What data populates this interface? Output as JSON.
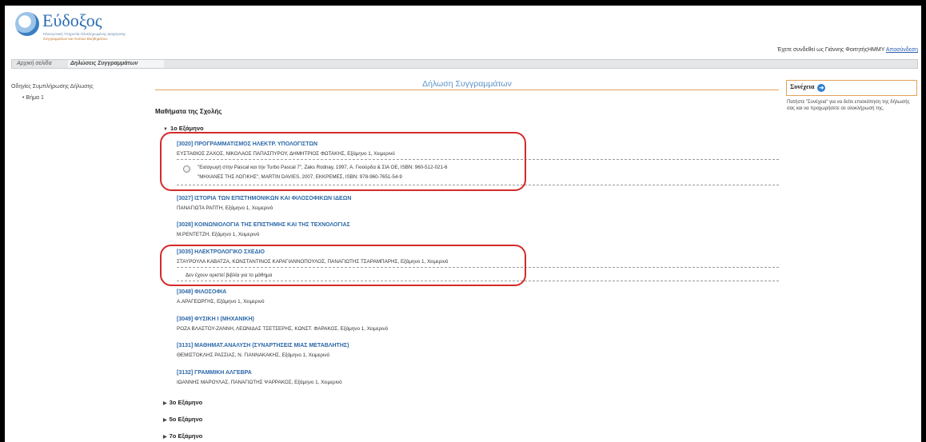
{
  "header": {
    "logo_name": "Εύδοξος",
    "logo_sub1": "Ηλεκτρονική Υπηρεσία Ολοκληρωμένης Διαχείρισης",
    "logo_sub2": "Συγγραμμάτων και Λοιπών Βοηθημάτων",
    "user_text": "Έχετε συνδεθεί ως Γιάννης ΦοιτητήςΗΜΜΥ",
    "logout_label": "Αποσύνδεση"
  },
  "tabs": {
    "home": "Αρχική σελίδα",
    "declarations": "Δηλώσεις Συγγραμμάτων"
  },
  "sidebar": {
    "title": "Οδηγίες Συμπλήρωσης Δήλωσης",
    "step": "• Βήμα 1"
  },
  "main": {
    "title": "Δήλωση Συγγραμμάτων",
    "school_title": "Μαθήματα της Σχολής",
    "semester_open": "1ο Εξάμηνο",
    "courses": [
      {
        "title": "[3020] ΠΡΟΓΡΑΜΜΑΤΙΣΜΟΣ ΗΛΕΚΤΡ. ΥΠΟΛΟΓΙΣΤΩΝ",
        "sub": "ΕΥΣΤΑΘΙΟΣ ΖΑΧΟΣ, ΝΙΚΟΛΑΟΣ ΠΑΠΑΣΠΥΡΟΥ, ΔΗΜΗΤΡΙΟΣ ΦΩΤΑΚΗΣ, Εξάμηνο 1, Χειμερινό",
        "book_line1": "\"Εισαγωγή στην Pascal και την Turbo Pascal 7\", Zaks Rodnay, 1997, Α. Γκιούρδα & ΣΙΑ ΟΕ, ISBN: 960-512-021-6",
        "book_line2": "\"ΜΗΧΑΝΕΣ ΤΗΣ ΛΟΓΙΚΗΣ\", MARTIN DAVIES, 2007, ΕΚΚΡΕΜΕΣ, ISBN: 978-960-7651-54-9"
      },
      {
        "title": "[3027] ΙΣΤΟΡΙΑ ΤΩΝ ΕΠΙΣΤΗΜΟΝΙΚΩΝ ΚΑΙ ΦΙΛΟΣΟΦΙΚΩΝ ΙΔΕΩΝ",
        "sub": "ΠΑΝΑΓΙΩΤΑ ΡΑΠΤΗ, Εξάμηνο 1, Χειμερινό"
      },
      {
        "title": "[3028] ΚΟΙΝΩΝΙΟΛΟΓΙΑ ΤΗΣ ΕΠΙΣΤΗΜΗΣ ΚΑΙ ΤΗΣ ΤΕΧΝΟΛΟΓΙΑΣ",
        "sub": "Μ.ΡΕΝΤΕΤΖΗ, Εξάμηνο 1, Χειμερινό"
      },
      {
        "title": "[3035] ΗΛΕΚΤΡΟΛΟΓΙΚΟ ΣΧΕΔΙΟ",
        "sub": "ΣΤΑΥΡΟΥΛΑ ΚΑΒΑΤΖΑ, ΚΩΝΣΤΑΝΤΙΝΟΣ ΚΑΡΑΓΙΑΝΝΟΠΟΥΛΟΣ, ΠΑΝΑΓΙΩΤΗΣ ΤΣΑΡΑΜΠΑΡΗΣ, Εξάμηνο 1, Χειμερινό",
        "no_books": "Δεν έχουν οριστεί βιβλία για το μάθημα"
      },
      {
        "title": "[3048] ΦΙΛΟΣΟΦΙΑ",
        "sub": "Α.ΑΡΑΓΕΩΡΓΗΣ, Εξάμηνο 1, Χειμερινό"
      },
      {
        "title": "[3049] ΦΥΣΙΚΗ Ι (ΜΗΧΑΝΙΚΗ)",
        "sub": "ΡΟΖΑ ΒΛΑΣΤΟΥ-ΖΑΝΝΗ, ΛΕΩΝΙΔΑΣ ΤΣΕΤΣΕΡΗΣ, ΚΩΝΣΤ. ΦΑΡΑΚΟΣ, Εξάμηνο 1, Χειμερινό"
      },
      {
        "title": "[3131] ΜΑΘΗΜΑΤ.ΑΝΑΛΥΣΗ (ΣΥΝΑΡΤΗΣΕΙΣ ΜΙΑΣ ΜΕΤΑΒΛΗΤΗΣ)",
        "sub": "ΘΕΜΙΣΤΟΚΛΗΣ ΡΑΣΣΙΑΣ, Ν. ΓΙΑΝΝΑΚΑΚΗΣ, Εξάμηνο 1, Χειμερινό"
      },
      {
        "title": "[3132] ΓΡΑΜΜΙΚΗ ΑΛΓΕΒΡΑ",
        "sub": "ΙΩΑΝΝΗΣ ΜΑΡΟΥΛΑΣ, ΠΑΝΑΓΙΩΤΗΣ ΨΑΡΡΑΚΟΣ, Εξάμηνο 1, Χειμερινό"
      }
    ],
    "semesters_closed": [
      "3ο Εξάμηνο",
      "5ο Εξάμηνο",
      "7ο Εξάμηνο"
    ]
  },
  "right_panel": {
    "continue_label": "Συνέχεια",
    "help_text": "Πατήστε \"Συνέχεια\" για να δείτε επισκόπηση της δήλωσής σας και να προχωρήσετε σε ολοκλήρωσή της."
  },
  "colors": {
    "link_blue": "#2c68a8",
    "title_blue": "#5c93c8",
    "accent_orange": "#e4a25a",
    "highlight_red": "#d42a2a"
  }
}
